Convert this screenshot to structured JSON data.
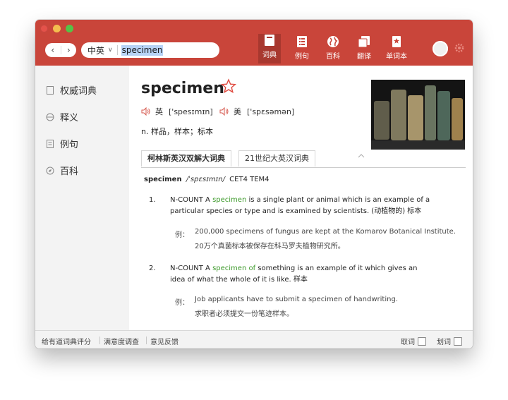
{
  "toolbar": {
    "nav_back": "‹",
    "nav_forward": "›",
    "lang_selector": "中英",
    "search_value": "specimen",
    "tabs": [
      {
        "label": "词典",
        "icon": "dictionary-icon",
        "active": true
      },
      {
        "label": "例句",
        "icon": "list-icon",
        "active": false
      },
      {
        "label": "百科",
        "icon": "globe-icon",
        "active": false
      },
      {
        "label": "翻译",
        "icon": "copy-icon",
        "active": false
      },
      {
        "label": "单词本",
        "icon": "bookmark-icon",
        "active": false
      }
    ]
  },
  "sidebar": {
    "items": [
      {
        "label": "权威词典",
        "icon": "document-icon"
      },
      {
        "label": "释义",
        "icon": "globe-icon"
      },
      {
        "label": "例句",
        "icon": "list-icon"
      },
      {
        "label": "百科",
        "icon": "compass-icon"
      }
    ]
  },
  "entry": {
    "word": "specimen",
    "uk_label": "英",
    "uk_phonetic": "['spesɪmɪn]",
    "us_label": "美",
    "us_phonetic": "['spɛsəmən]",
    "gloss": "n. 样品，样本；标本",
    "dict_tabs": [
      "柯林斯英汉双解大词典",
      "21世纪大英汉词典"
    ],
    "headword": "specimen",
    "headword_phonetic": "/ˈspɛsɪmɪn/",
    "levels": "CET4 TEM4",
    "senses": [
      {
        "num": "1.",
        "pre": "N-COUNT A ",
        "hl": "specimen",
        "post": " is a single plant or animal which is an example of a particular species or type and is examined by scientists. (动植物的) 标本",
        "ex_label": "例：",
        "ex_en": "200,000 specimens of fungus are kept at the Komarov Botanical Institute.",
        "ex_zh": "20万个真菌标本被保存在科马罗夫植物研究所。"
      },
      {
        "num": "2.",
        "pre": "N-COUNT A ",
        "hl": "specimen of",
        "post": " something is an example of it which gives an idea of what the whole of it is like. 样本",
        "ex_label": "例：",
        "ex_en": "Job applicants have to submit a specimen of handwriting.",
        "ex_zh": "求职者必须提交一份笔迹样本。"
      }
    ]
  },
  "status": {
    "links": [
      "给有道词典评分",
      "满意度调查",
      "意见反馈"
    ],
    "opt1": "取词",
    "opt2": "划词"
  },
  "colors": {
    "toolbar": "#c9453a",
    "toolbar_active": "#a8382f",
    "highlight": "#3d9a2b",
    "star": "#e04a3f"
  }
}
